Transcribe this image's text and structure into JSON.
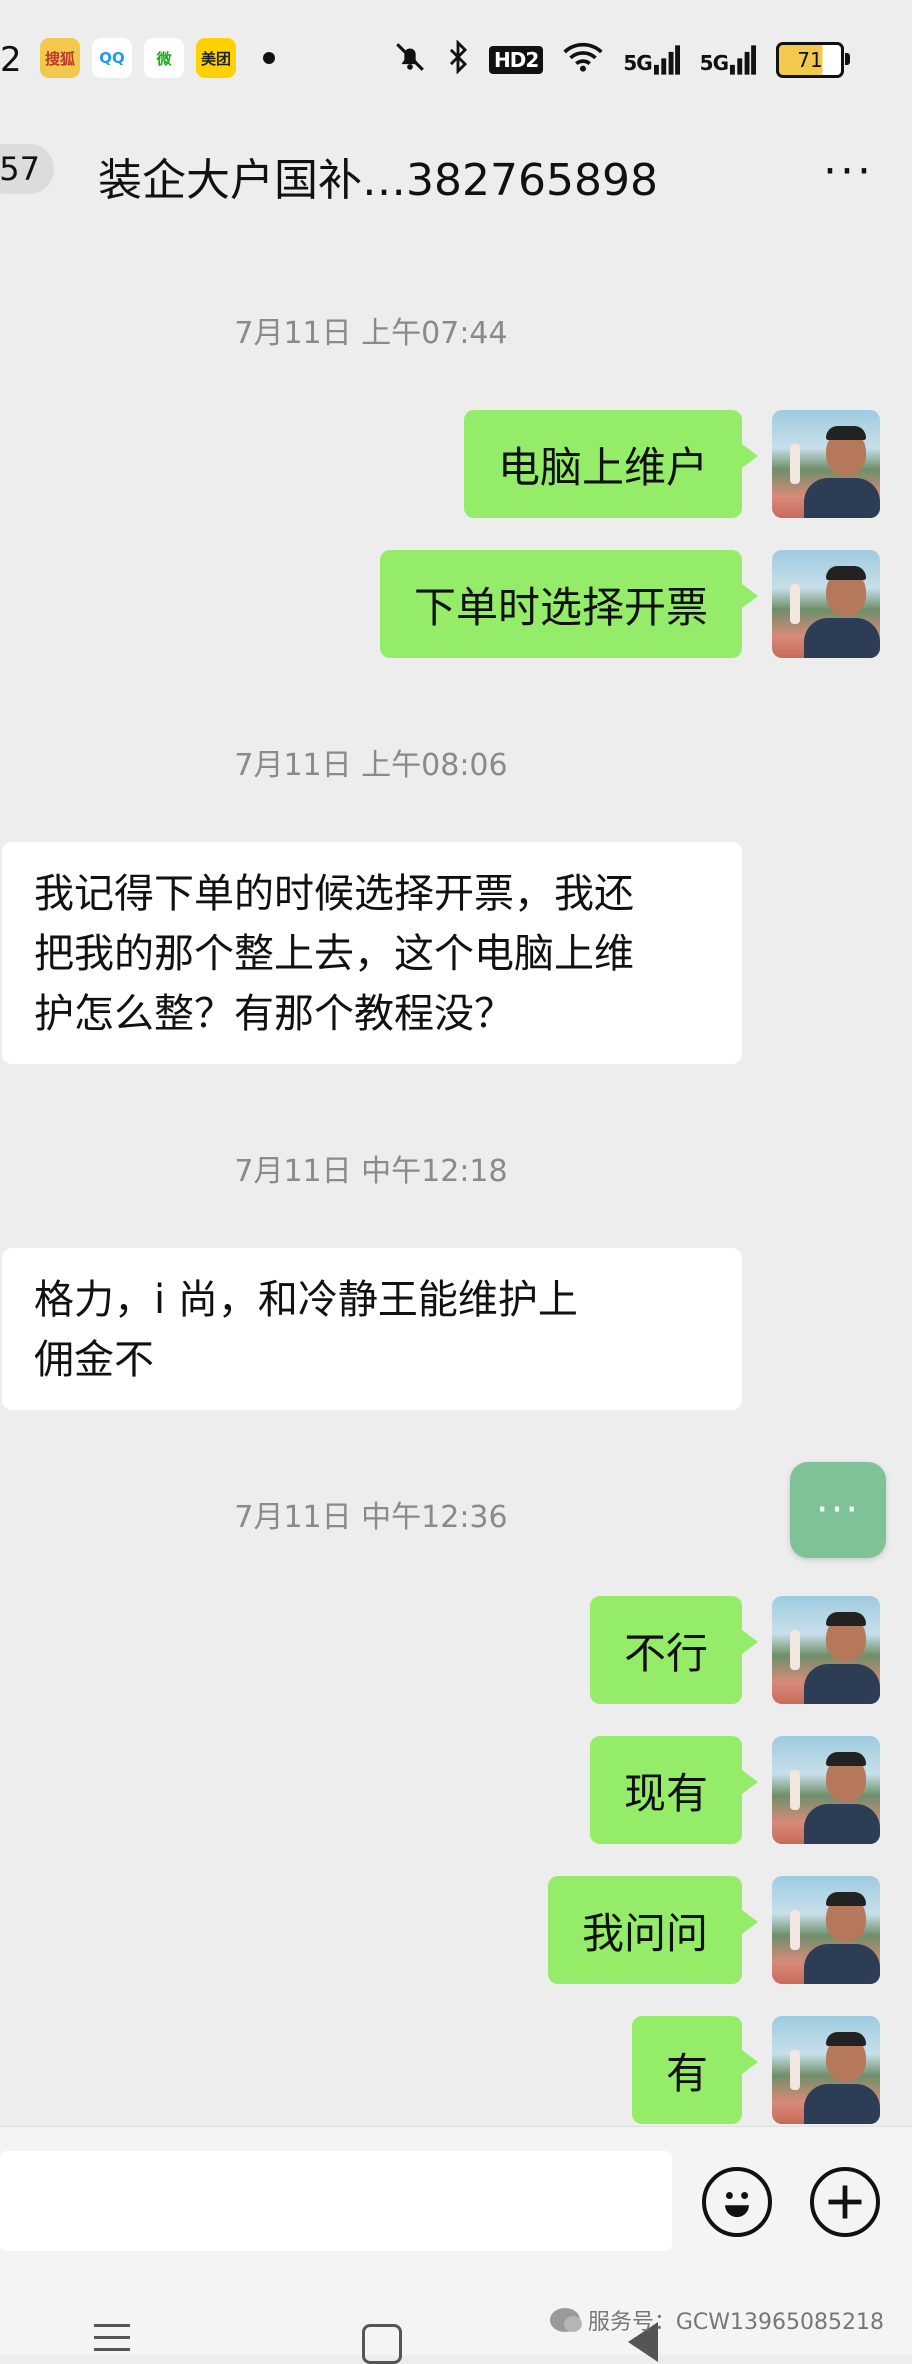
{
  "status_bar": {
    "left_number": "2",
    "apps": [
      {
        "label": "搜狐",
        "bg": "#f2c94c",
        "fg": "#c0392b"
      },
      {
        "label": "QQ",
        "bg": "#ffffff",
        "fg": "#1e9bf0"
      },
      {
        "label": "微",
        "bg": "#ffffff",
        "fg": "#1aad19"
      },
      {
        "label": "美团",
        "bg": "#ffd100",
        "fg": "#222222"
      }
    ],
    "icons": [
      "bell-off",
      "bluetooth",
      "hd2",
      "wifi",
      "5g-signal",
      "5g-signal",
      "battery"
    ],
    "hd": "HD2",
    "signal1": "5G",
    "signal2": "5G",
    "battery": "71"
  },
  "header": {
    "unread": "57",
    "title": "装企大户国补…382765898",
    "more": "···"
  },
  "messages": [
    {
      "type": "time",
      "text": "7月11日 上午07:44"
    },
    {
      "type": "out",
      "text": "电脑上维户"
    },
    {
      "type": "out",
      "text": "下单时选择开票"
    },
    {
      "type": "time",
      "text": "7月11日 上午08:06"
    },
    {
      "type": "in",
      "lines": [
        "我记得下单的时候选择开票，我还",
        "把我的那个整上去，这个电脑上维",
        "护怎么整？有那个教程没？"
      ]
    },
    {
      "type": "time",
      "text": "7月11日 中午12:18"
    },
    {
      "type": "in",
      "lines": [
        "格力，i 尚，和冷静王能维护上",
        "佣金不"
      ]
    },
    {
      "type": "time",
      "text": "7月11日 中午12:36"
    },
    {
      "type": "out",
      "text": "不行"
    },
    {
      "type": "out",
      "text": "现有"
    },
    {
      "type": "out",
      "text": "我问问"
    },
    {
      "type": "out",
      "text": "有"
    }
  ],
  "floating_button": "···",
  "input_bar": {
    "emoji_icon": "smile-icon",
    "plus_icon": "plus-icon"
  },
  "watermark": "服务号：GCW13965085218",
  "colors": {
    "outgoing_bubble": "#95ec69",
    "incoming_bubble": "#ffffff",
    "background": "#ededed"
  }
}
